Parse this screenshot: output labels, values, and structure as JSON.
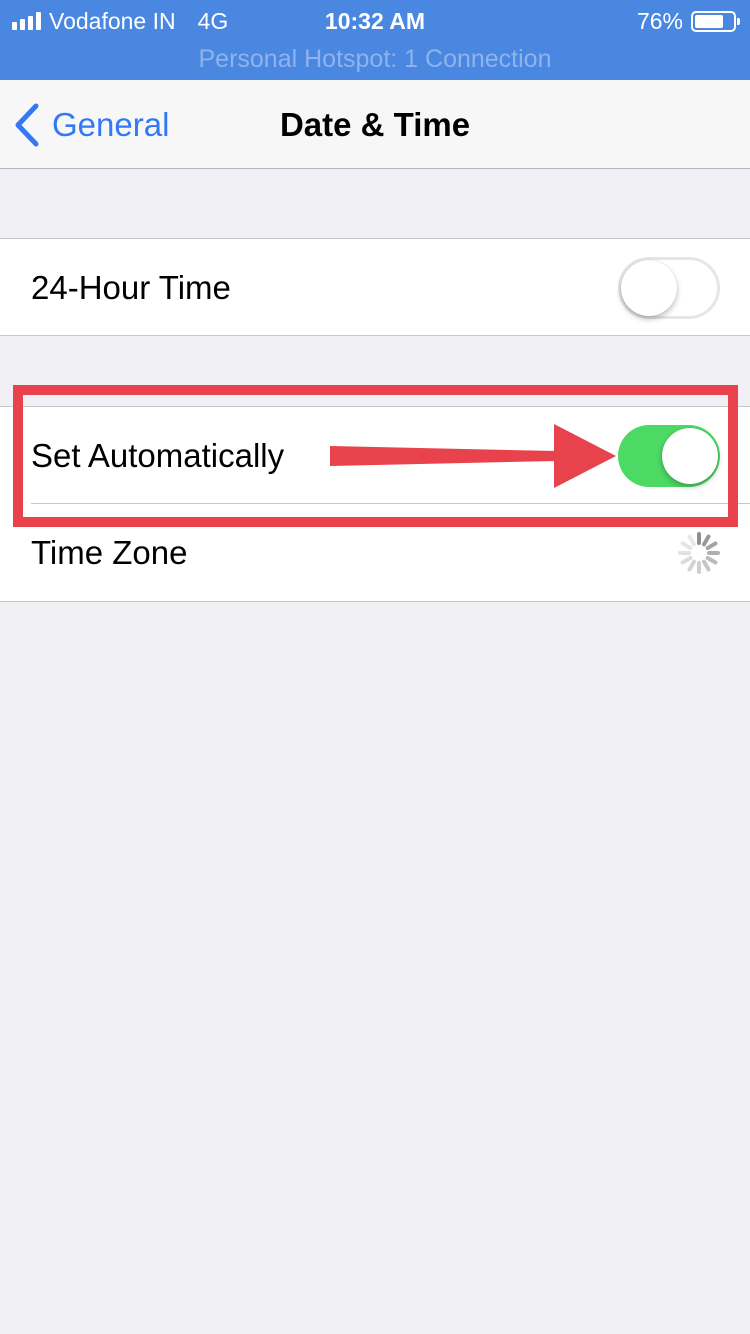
{
  "status_bar": {
    "carrier": "Vodafone IN",
    "network": "4G",
    "time": "10:32 AM",
    "battery_percent": "76%",
    "battery_level": 0.76,
    "hotspot_banner": "Personal Hotspot: 1 Connection"
  },
  "nav": {
    "back_label": "General",
    "title": "Date & Time"
  },
  "settings": {
    "hour24": {
      "label": "24-Hour Time",
      "enabled": false
    },
    "set_automatically": {
      "label": "Set Automatically",
      "enabled": true
    },
    "time_zone": {
      "label": "Time Zone"
    }
  },
  "colors": {
    "status_bar_bg": "#4a87e0",
    "accent": "#3478f6",
    "toggle_on": "#4cd964",
    "annotation": "#e8434d",
    "background": "#efeff4"
  },
  "icons": {
    "back": "chevron-left-icon",
    "loading": "spinner-icon",
    "signal": "cellular-signal-icon",
    "battery": "battery-icon"
  }
}
